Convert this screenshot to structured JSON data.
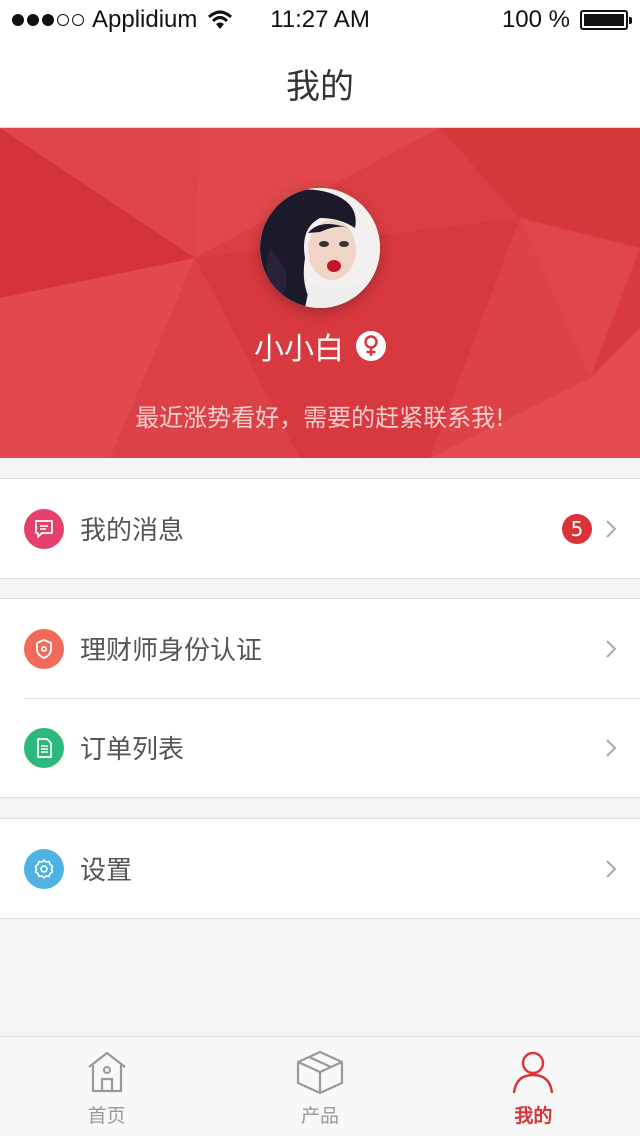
{
  "status_bar": {
    "carrier": "Applidium",
    "time": "11:27 AM",
    "battery": "100 %"
  },
  "nav": {
    "title": "我的"
  },
  "profile": {
    "username": "小小白",
    "tagline": "最近涨势看好，需要的赶紧联系我!"
  },
  "menu": {
    "messages": {
      "label": "我的消息",
      "badge": "5",
      "icon_color": "#e6416d",
      "icon": "message-icon"
    },
    "certification": {
      "label": "理财师身份认证",
      "icon_color": "#f26a5a",
      "icon": "shield-icon"
    },
    "orders": {
      "label": "订单列表",
      "icon_color": "#2db87d",
      "icon": "document-icon"
    },
    "settings": {
      "label": "设置",
      "icon_color": "#4fb2e0",
      "icon": "gear-icon"
    }
  },
  "tabs": [
    {
      "label": "首页",
      "icon": "home-icon",
      "active": false
    },
    {
      "label": "产品",
      "icon": "box-icon",
      "active": false
    },
    {
      "label": "我的",
      "icon": "person-icon",
      "active": true
    }
  ],
  "colors": {
    "accent": "#d93237",
    "header_red": "#d93a3f"
  }
}
